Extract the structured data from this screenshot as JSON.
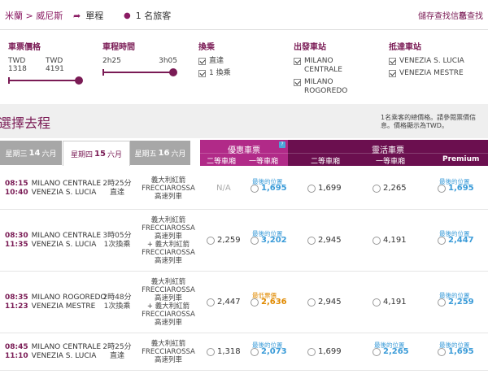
{
  "topbar": {
    "route": "米蘭 > 威尼斯",
    "oneway": "單程",
    "passengers": "1 名旅客",
    "save_link": "儲存查找信息",
    "new_link": "新查找"
  },
  "filters": {
    "price": {
      "title": "車票價格",
      "min": "TWD 1318",
      "max": "TWD 4191"
    },
    "duration": {
      "title": "車程時間",
      "min": "2h25",
      "max": "3h05"
    },
    "transfers": {
      "title": "換乘",
      "options": [
        "直達",
        "1 換乘"
      ]
    },
    "origin": {
      "title": "出發車站",
      "options": [
        "MILANO CENTRALE",
        "MILANO ROGOREDO"
      ]
    },
    "destination": {
      "title": "抵達車站",
      "options": [
        "VENEZIA S. LUCIA",
        "VENEZIA MESTRE"
      ]
    }
  },
  "results": {
    "title": "選擇去程",
    "price_note": "1名乘客的總價格。請參閱票價信息。價格顯示為TWD。",
    "days": [
      {
        "weekday": "星期三",
        "day": "14",
        "month": "六月"
      },
      {
        "weekday": "星期四",
        "day": "15",
        "month": "六月"
      },
      {
        "weekday": "星期五",
        "day": "16",
        "month": "六月"
      }
    ],
    "fare_groups": {
      "economy": {
        "title": "優惠車票",
        "badge": "?",
        "cols": [
          "二等車廂",
          "一等車廂"
        ]
      },
      "express": {
        "title": "靈活車票",
        "cols": [
          "二等車廂",
          "一等車廂",
          "Premium"
        ]
      }
    },
    "rows": [
      {
        "dep_time": "08:15",
        "dep_station": "MILANO CENTRALE",
        "arr_time": "10:40",
        "arr_station": "VENEZIA S. LUCIA",
        "duration": "2時25分",
        "changes": "直達",
        "train": [
          "義大利紅箭",
          "FRECCIAROSSA",
          "高速列車"
        ],
        "fares": [
          {
            "price": "N/A",
            "label": "",
            "style": "na"
          },
          {
            "price": "1,695",
            "label": "最後的位置",
            "style": "blue"
          },
          {
            "price": "1,699",
            "label": "",
            "style": "normal"
          },
          {
            "price": "2,265",
            "label": "",
            "style": "normal"
          },
          {
            "price": "1,695",
            "label": "最後的位置",
            "style": "blue"
          }
        ]
      },
      {
        "dep_time": "08:30",
        "dep_station": "MILANO CENTRALE",
        "arr_time": "11:35",
        "arr_station": "VENEZIA S. LUCIA",
        "duration": "3時05分",
        "changes": "1次換乘",
        "train": [
          "義大利紅箭",
          "FRECCIAROSSA",
          "高速列車",
          "+ 義大利紅箭",
          "FRECCIAROSSA",
          "高速列車"
        ],
        "fares": [
          {
            "price": "2,259",
            "label": "",
            "style": "normal"
          },
          {
            "price": "3,202",
            "label": "最後的位置",
            "style": "blue"
          },
          {
            "price": "2,945",
            "label": "",
            "style": "normal"
          },
          {
            "price": "4,191",
            "label": "",
            "style": "normal"
          },
          {
            "price": "2,447",
            "label": "最後的位置",
            "style": "blue"
          }
        ]
      },
      {
        "dep_time": "08:35",
        "dep_station": "MILANO ROGOREDO",
        "arr_time": "11:23",
        "arr_station": "VENEZIA MESTRE",
        "duration": "2時48分",
        "changes": "1次換乘",
        "train": [
          "義大利紅箭",
          "FRECCIAROSSA",
          "高速列車",
          "+ 義大利紅箭",
          "FRECCIAROSSA",
          "高速列車"
        ],
        "fares": [
          {
            "price": "2,447",
            "label": "",
            "style": "normal"
          },
          {
            "price": "2,636",
            "label": "最低票價",
            "style": "orange"
          },
          {
            "price": "2,945",
            "label": "",
            "style": "normal"
          },
          {
            "price": "4,191",
            "label": "",
            "style": "normal"
          },
          {
            "price": "2,259",
            "label": "最後的位置",
            "style": "blue"
          }
        ]
      },
      {
        "dep_time": "08:45",
        "dep_station": "MILANO CENTRALE",
        "arr_time": "11:10",
        "arr_station": "VENEZIA S. LUCIA",
        "duration": "2時25分",
        "changes": "直達",
        "train": [
          "義大利紅箭",
          "FRECCIAROSSA",
          "高速列車"
        ],
        "fares": [
          {
            "price": "1,318",
            "label": "",
            "style": "normal"
          },
          {
            "price": "2,073",
            "label": "最後的位置",
            "style": "blue"
          },
          {
            "price": "1,699",
            "label": "",
            "style": "normal"
          },
          {
            "price": "2,265",
            "label": "最後的位置",
            "style": "blue"
          },
          {
            "price": "1,695",
            "label": "最後的位置",
            "style": "blue"
          }
        ]
      }
    ]
  }
}
